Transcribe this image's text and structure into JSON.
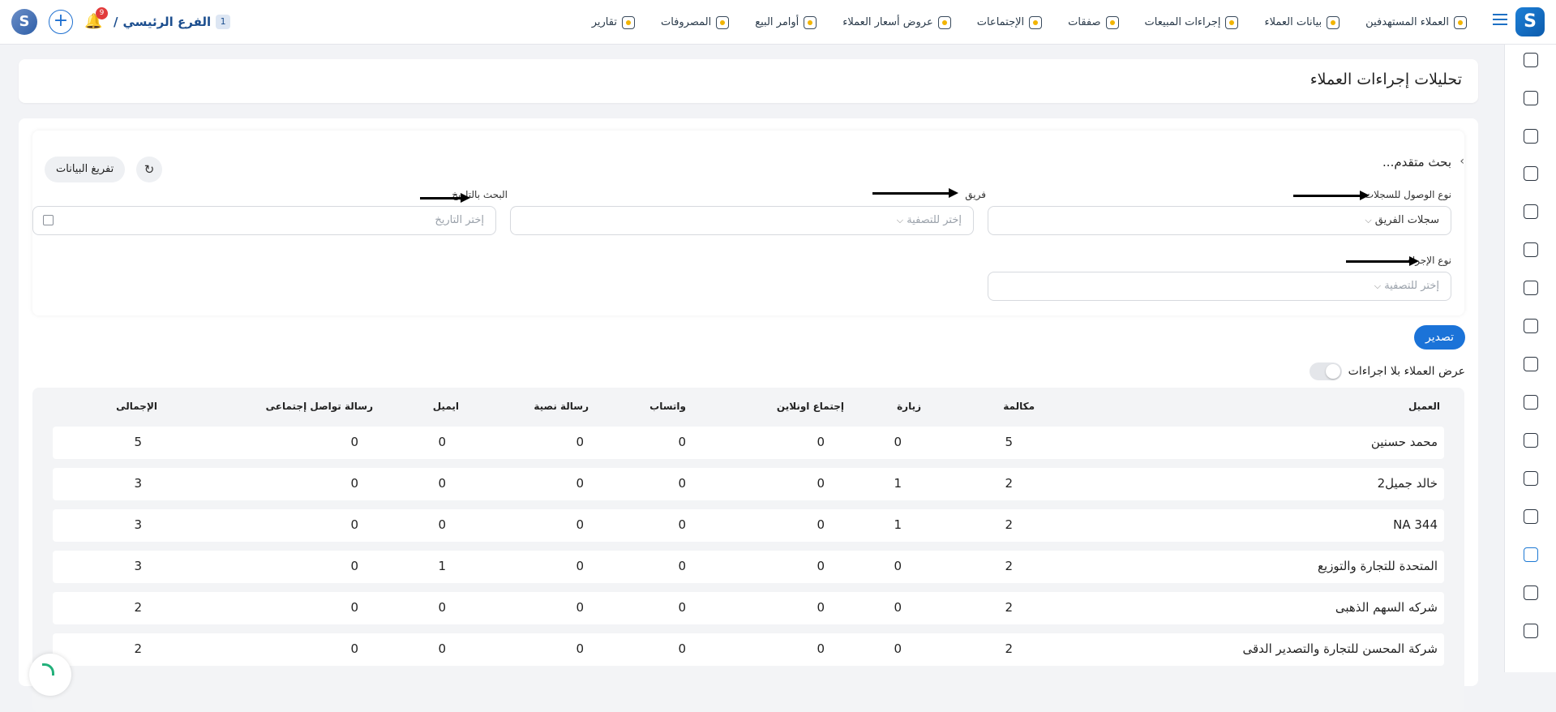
{
  "nav": {
    "items": [
      {
        "label": "العملاء المستهدفين",
        "icon": "target-clients-icon"
      },
      {
        "label": "بيانات العملاء",
        "icon": "client-data-icon"
      },
      {
        "label": "إجراءات المبيعات",
        "icon": "sales-actions-icon"
      },
      {
        "label": "صفقات",
        "icon": "deals-icon"
      },
      {
        "label": "الإجتماعات",
        "icon": "meetings-icon"
      },
      {
        "label": "عروض أسعار العملاء",
        "icon": "quotes-icon"
      },
      {
        "label": "أوامر البيع",
        "icon": "sales-orders-icon"
      },
      {
        "label": "المصروفات",
        "icon": "expenses-icon"
      },
      {
        "label": "تقارير",
        "icon": "reports-icon"
      }
    ]
  },
  "header": {
    "branch_label": "الفرع الرئيسي",
    "branch_slash": "/",
    "branch_number": "1",
    "notification_count": "9",
    "plus_label": "+"
  },
  "page": {
    "title": "تحليلات إجراءات العملاء"
  },
  "filters": {
    "advanced_title": "بحث متقدم...",
    "clear_button": "تفريغ البيانات",
    "refresh_glyph": "↻",
    "access_type_label": "نوع الوصول للسجلات",
    "access_type_value": "سجلات الفريق",
    "team_label": "فريق",
    "team_placeholder": "إختر للتصفية",
    "date_label": "البحث بالتاريخ",
    "date_placeholder": "إختر التاريخ",
    "action_type_label": "نوع الإجراء",
    "action_type_placeholder": "إختر للتصفية",
    "chevron": "⌵"
  },
  "actions": {
    "export_button": "تصدير",
    "toggle_label": "عرض العملاء بلا اجراءات"
  },
  "table": {
    "headers": {
      "client": "العميل",
      "call": "مكالمة",
      "visit": "زيارة",
      "online_meeting": "إجتماع اونلاين",
      "whatsapp": "واتساب",
      "sms": "رسالة نصية",
      "email": "ايميل",
      "social": "رسالة تواصل إجتماعى",
      "total": "الإجمالى"
    },
    "rows": [
      {
        "client": "محمد حسنين",
        "call": "5",
        "visit": "0",
        "online_meeting": "0",
        "whatsapp": "0",
        "sms": "0",
        "email": "0",
        "social": "0",
        "total": "5"
      },
      {
        "client": "خالد جميل2",
        "call": "2",
        "visit": "1",
        "online_meeting": "0",
        "whatsapp": "0",
        "sms": "0",
        "email": "0",
        "social": "0",
        "total": "3"
      },
      {
        "client": "NA 344",
        "call": "2",
        "visit": "1",
        "online_meeting": "0",
        "whatsapp": "0",
        "sms": "0",
        "email": "0",
        "social": "0",
        "total": "3"
      },
      {
        "client": "المتحدة  للتجارة والتوزيع",
        "call": "2",
        "visit": "0",
        "online_meeting": "0",
        "whatsapp": "0",
        "sms": "0",
        "email": "1",
        "social": "0",
        "total": "3"
      },
      {
        "client": "شركه السهم الذهبى",
        "call": "2",
        "visit": "0",
        "online_meeting": "0",
        "whatsapp": "0",
        "sms": "0",
        "email": "0",
        "social": "0",
        "total": "2"
      },
      {
        "client": "شركة المحسن للتجارة والتصدير الدقى",
        "call": "2",
        "visit": "0",
        "online_meeting": "0",
        "whatsapp": "0",
        "sms": "0",
        "email": "0",
        "social": "0",
        "total": "2"
      }
    ]
  },
  "colors": {
    "accent": "#1b73d8",
    "badge": "#e23b3b"
  }
}
